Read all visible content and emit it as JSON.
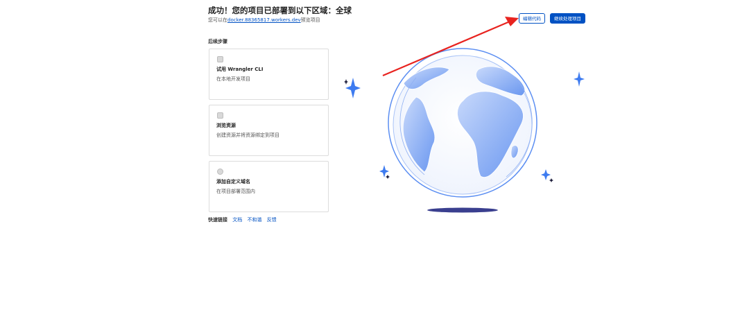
{
  "header": {
    "title": "成功！您的项目已部署到以下区域：全球",
    "subtitle_prefix": "您可以在",
    "subtitle_link": "docker.88365817.workers.dev",
    "subtitle_suffix": "预览项目"
  },
  "actions": {
    "edit_code": "编辑代码",
    "continue_project": "继续处理项目"
  },
  "next_steps": {
    "label": "后续步骤",
    "cards": [
      {
        "icon": "terminal-icon",
        "title": "试用 Wrangler CLI",
        "desc": "在本地开发项目"
      },
      {
        "icon": "link-icon",
        "title": "浏览资源",
        "desc": "创建资源并将资源绑定到项目"
      },
      {
        "icon": "globe-icon",
        "title": "添加自定义域名",
        "desc": "在项目部署范围内"
      }
    ]
  },
  "quick_links": {
    "label": "快速链接",
    "links": [
      "文档",
      "不和谐",
      "反馈"
    ]
  },
  "colors": {
    "accent": "#0051c3",
    "globe_land": "#7aa6f3",
    "annotation_arrow": "#e8231f",
    "sparkle": "#3d7bf0"
  }
}
